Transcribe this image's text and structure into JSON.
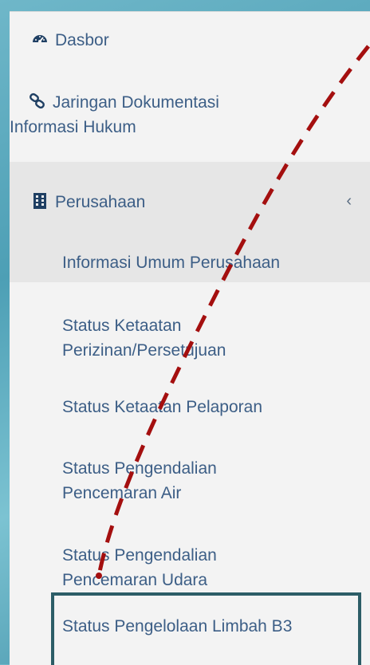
{
  "menu": {
    "dasbor": {
      "label": "Dasbor",
      "icon": "dashboard-icon"
    },
    "jdih": {
      "label_line1": "Jaringan Dokumentasi",
      "label_line2": "Informasi Hukum",
      "icon": "link-icon"
    },
    "perusahaan": {
      "label": "Perusahaan",
      "icon": "building-icon",
      "expanded": true
    },
    "submenu": [
      {
        "line1": "Informasi Umum Perusahaan",
        "line2": ""
      },
      {
        "line1": "Status Ketaatan",
        "line2": "Perizinan/Persetujuan"
      },
      {
        "line1": "Status Ketaatan Pelaporan",
        "line2": ""
      },
      {
        "line1": "Status Pengendalian",
        "line2": "Pencemaran Air"
      },
      {
        "line1": "Status Pengendalian",
        "line2": "Pencemaran Udara"
      },
      {
        "line1": "Status Pengelolaan Limbah B3",
        "line2": ""
      }
    ]
  },
  "colors": {
    "link": "#3c5e86",
    "annotation": "#a40f0f",
    "highlight_border": "#2c5d67"
  }
}
